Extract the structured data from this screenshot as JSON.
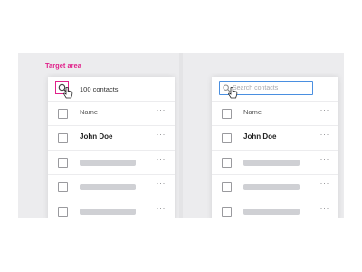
{
  "annotation": {
    "target_label": "Target area",
    "color": "#e0218a"
  },
  "left_panel": {
    "search_button_icon": "search-icon",
    "contacts_count": "100 contacts",
    "header_label": "Name",
    "rows": [
      {
        "name": "John Doe"
      },
      {
        "name": ""
      },
      {
        "name": ""
      },
      {
        "name": ""
      }
    ],
    "more_label": "···"
  },
  "right_panel": {
    "search_placeholder": "Search contacts",
    "search_value": "",
    "header_label": "Name",
    "rows": [
      {
        "name": "John Doe"
      },
      {
        "name": ""
      },
      {
        "name": ""
      },
      {
        "name": ""
      }
    ],
    "more_label": "···",
    "focus_color": "#4a8fe0"
  }
}
